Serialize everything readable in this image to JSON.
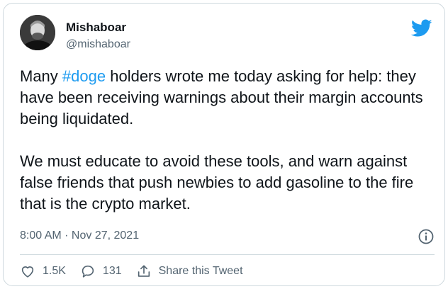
{
  "author": {
    "display_name": "Mishaboar",
    "handle": "@mishaboar"
  },
  "tweet": {
    "text_before_hashtag": "Many ",
    "hashtag": "#doge",
    "text_after_hashtag": " holders wrote me today asking for help: they have been receiving warnings about their margin accounts being liquidated.",
    "paragraph_2": "We must educate to avoid these tools, and warn against false friends that push newbies to add gasoline to the fire that is the crypto market.",
    "timestamp": "8:00 AM · Nov 27, 2021"
  },
  "actions": {
    "likes": "1.5K",
    "replies": "131",
    "share_label": "Share this Tweet"
  },
  "icons": {
    "brand": "twitter-bird-icon",
    "info": "info-icon",
    "like": "heart-icon",
    "reply": "reply-icon",
    "share": "share-icon"
  },
  "colors": {
    "brand": "#1d9bf0",
    "text": "#0f1419",
    "secondary": "#536471",
    "border": "#cfd9de"
  }
}
